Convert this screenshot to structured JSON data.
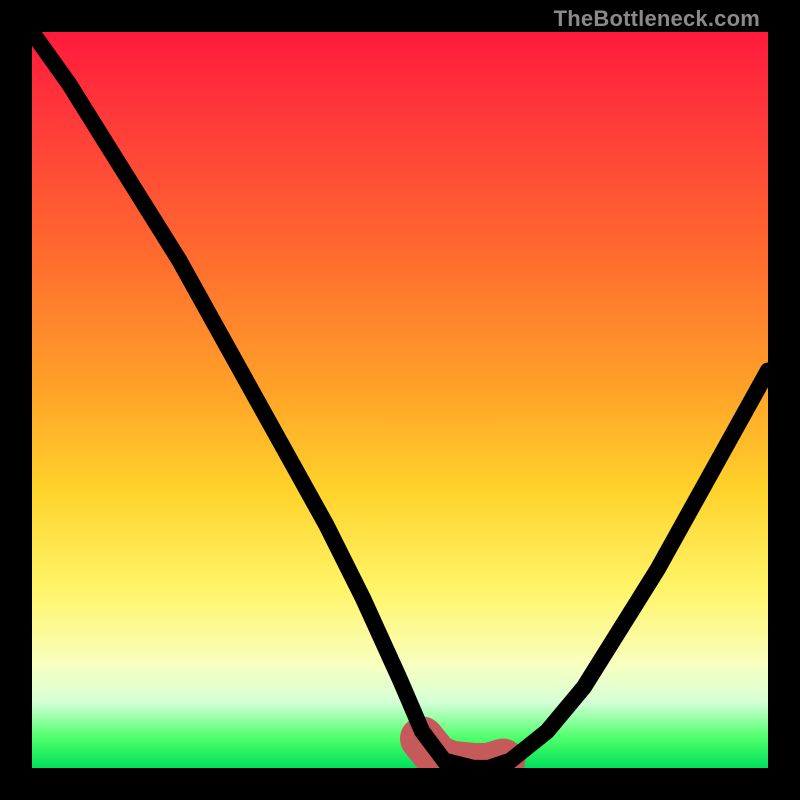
{
  "watermark": {
    "text": "TheBottleneck.com"
  },
  "colors": {
    "background": "#000000",
    "curve": "#000000",
    "trough": "#c65a5a",
    "gradient_stops": [
      "#ff1a3c",
      "#ff3a3a",
      "#ff6a2f",
      "#ffa028",
      "#ffd22a",
      "#fff56a",
      "#f9ffc0",
      "#d6ffd6",
      "#4cff6a",
      "#00e05c"
    ]
  },
  "chart_data": {
    "type": "line",
    "title": "",
    "xlabel": "",
    "ylabel": "",
    "xlim": [
      0,
      100
    ],
    "ylim": [
      0,
      100
    ],
    "grid": false,
    "legend": false,
    "series": [
      {
        "name": "bottleneck-curve",
        "x": [
          0,
          5,
          10,
          15,
          20,
          25,
          30,
          35,
          40,
          45,
          50,
          53,
          56,
          60,
          62,
          65,
          70,
          75,
          80,
          85,
          90,
          95,
          100
        ],
        "y": [
          100,
          93,
          85,
          77,
          69,
          60,
          51,
          42,
          33,
          23,
          12,
          5,
          1,
          0,
          0,
          1,
          5,
          11,
          19,
          27,
          36,
          45,
          54
        ]
      }
    ],
    "annotations": [
      {
        "name": "optimal-range",
        "x_start": 53,
        "x_end": 65,
        "y": 0,
        "style": "trough-marker"
      }
    ]
  }
}
